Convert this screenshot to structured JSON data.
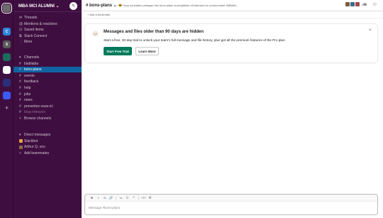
{
  "rail": {
    "workspaces": [
      {
        "label": "",
        "color": "#6b6b6b",
        "active": true
      },
      {
        "label": "C",
        "color": "#2e86de",
        "active": false
      },
      {
        "label": "S",
        "color": "#5a5a5a",
        "active": false
      },
      {
        "label": "",
        "color": "#1b6b5a",
        "active": false
      },
      {
        "label": "",
        "color": "#ffffff",
        "active": false
      },
      {
        "label": "",
        "color": "#2a2f7a",
        "active": false
      },
      {
        "label": "",
        "color": "#3d5afe",
        "active": false
      }
    ],
    "add_label": "+"
  },
  "sidebar": {
    "workspace_name": "MBA MCI ALUMNI",
    "caret": "⌄",
    "nav": [
      {
        "icon": "threads-icon",
        "glyph": "✉",
        "label": "Threads"
      },
      {
        "icon": "at-icon",
        "glyph": "@",
        "label": "Mentions & reactions"
      },
      {
        "icon": "bookmark-icon",
        "glyph": "⊡",
        "label": "Saved items"
      },
      {
        "icon": "connect-icon",
        "glyph": "⧉",
        "label": "Slack Connect"
      },
      {
        "icon": "more-icon",
        "glyph": "⋮",
        "label": "More"
      }
    ],
    "channels_header": "Channels",
    "channels": [
      {
        "label": "blablabla",
        "active": false,
        "muted": false
      },
      {
        "label": "bons-plans",
        "active": true,
        "muted": false
      },
      {
        "label": "events",
        "active": false,
        "muted": false
      },
      {
        "label": "feedback",
        "active": false,
        "muted": false
      },
      {
        "label": "help",
        "active": false,
        "muted": false
      },
      {
        "label": "jobs",
        "active": false,
        "muted": false
      },
      {
        "label": "news",
        "active": false,
        "muted": false
      },
      {
        "label": "presentez-vous-ici",
        "active": false,
        "muted": false
      },
      {
        "label": "blog-releases",
        "active": false,
        "muted": true
      }
    ],
    "browse_channels": "Browse channels",
    "dm_header": "Direct messages",
    "dms": [
      {
        "label": "Slackbot",
        "color": "#e8a33c"
      },
      {
        "label": "Arthur Q. you",
        "color": "#8a6a4a"
      }
    ],
    "add_teammates": "Add teammates"
  },
  "header": {
    "channel_title": "# bons-plans",
    "caret": "⌄",
    "topic": "😎 Vous souhaitez partager des bons plans susceptibles d'intéresser la communauté #MBAM...",
    "member_count": "119",
    "member_colors": [
      "#7a5c3a",
      "#3a6a8a",
      "#a04a4a"
    ],
    "bookmark_label": "+ Add a bookmark"
  },
  "banner": {
    "title": "Messages and files older than 90 days are hidden",
    "body": "Start a free, 30-day trial to unlock your team's full message and file history, plus get all the premium features of the Pro plan.",
    "primary_button": "Start Free Trial",
    "secondary_button": "Learn More",
    "close_glyph": "×"
  },
  "composer": {
    "placeholder": "Message #bons-plans",
    "tools": [
      {
        "name": "bold-icon",
        "glyph": "B",
        "cls": "bold"
      },
      {
        "name": "italic-icon",
        "glyph": "I",
        "cls": "it"
      },
      {
        "name": "strikethrough-icon",
        "glyph": "S̶",
        "cls": ""
      },
      {
        "name": "link-icon",
        "glyph": "🔗",
        "cls": ""
      },
      {
        "name": "ordered-list-icon",
        "glyph": "≔",
        "cls": ""
      },
      {
        "name": "bullet-list-icon",
        "glyph": "☰",
        "cls": ""
      },
      {
        "name": "blockquote-icon",
        "glyph": "❝",
        "cls": ""
      },
      {
        "name": "code-icon",
        "glyph": "</>",
        "cls": ""
      },
      {
        "name": "code-block-icon",
        "glyph": "⌘",
        "cls": ""
      }
    ]
  }
}
